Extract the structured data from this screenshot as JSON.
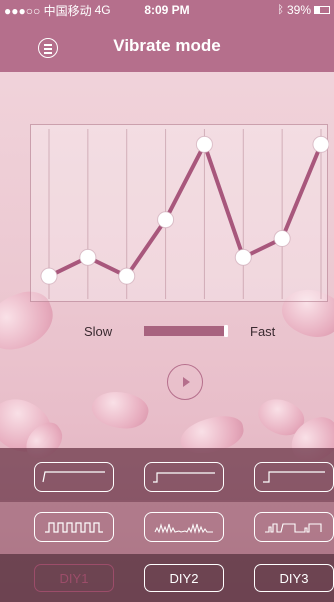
{
  "status_bar": {
    "carrier": "●●●○○ 中国移动",
    "network": "4G",
    "time": "8:09 PM",
    "bluetooth": "bluetooth-icon",
    "battery": "39%",
    "battery_level": 0.39
  },
  "header": {
    "title": "Vibrate mode",
    "menu_icon": "menu-icon"
  },
  "speed": {
    "slow_label": "Slow",
    "fast_label": "Fast",
    "level": 1.0
  },
  "chart_data": {
    "type": "line",
    "levels": [
      1,
      2,
      1,
      4,
      8,
      2,
      3,
      8
    ],
    "ylim": [
      0,
      8.5
    ],
    "grid": true,
    "color": "#a8577c"
  },
  "modes": {
    "row1": [
      "step-pattern-1",
      "step-pattern-2",
      "step-pattern-3"
    ],
    "row2": [
      "pulse-pattern-1",
      "wave-pattern-2",
      "burst-pattern-3"
    ],
    "diy": [
      "DIY1",
      "DIY2",
      "DIY3"
    ]
  },
  "colors": {
    "accent": "#b56f8c",
    "line": "#a8577c",
    "dim": "#9c4d6a"
  }
}
